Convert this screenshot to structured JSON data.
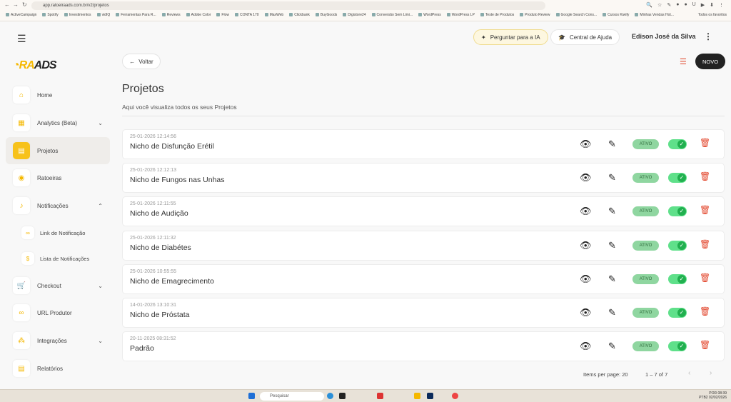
{
  "browser": {
    "url": "app.ratoeiraads.com.br/v2/projetos",
    "bookmarks": [
      "ActiveCampaign",
      "Spotify",
      "Investimentos",
      "vidIQ",
      "Ferramentas Para R...",
      "Reviews",
      "Adobe Color",
      "Flow",
      "CONTA 170",
      "MaxWeb",
      "Clickbank",
      "BuyGoods",
      "Digistore24",
      "Conversão Sem Limi...",
      "WordPress",
      "WordPress LP",
      "Teste de Produtos",
      "Produto Review",
      "Google Search Cons...",
      "Cursos Kiwify",
      "Minhas Vendas Hot..."
    ],
    "all_bookmarks": "Todos os favoritos"
  },
  "logo": {
    "part1": "RA",
    "part2": "ADS"
  },
  "sidebar": {
    "items": [
      {
        "label": "Home",
        "icon": "home-icon"
      },
      {
        "label": "Analytics (Beta)",
        "icon": "dashboard-icon"
      },
      {
        "label": "Projetos",
        "icon": "clipboard-icon"
      },
      {
        "label": "Ratoeiras",
        "icon": "mouse-icon"
      },
      {
        "label": "Notificações",
        "icon": "bell-icon"
      },
      {
        "label": "Link de Notificação",
        "icon": "link-icon"
      },
      {
        "label": "Lista de Notificações",
        "icon": "dollar-icon"
      },
      {
        "label": "Checkout",
        "icon": "cart-icon"
      },
      {
        "label": "URL Produtor",
        "icon": "link-icon"
      },
      {
        "label": "Integrações",
        "icon": "integrations-icon"
      },
      {
        "label": "Relatórios",
        "icon": "report-icon"
      }
    ]
  },
  "header": {
    "ask_ai": "Perguntar para a IA",
    "help": "Central de Ajuda",
    "user": "Edison José da Silva"
  },
  "toolbar": {
    "back": "Voltar",
    "new": "NOVO"
  },
  "page": {
    "title": "Projetos",
    "subtitle": "Aqui você visualiza todos os seus Projetos"
  },
  "projects": [
    {
      "date": "25-01-2026 12:14:56",
      "name": "Nicho de Disfunção Erétil",
      "status": "ATIVO",
      "enabled": true
    },
    {
      "date": "25-01-2026 12:12:13",
      "name": "Nicho de Fungos nas Unhas",
      "status": "ATIVO",
      "enabled": true
    },
    {
      "date": "25-01-2026 12:11:55",
      "name": "Nicho de Audição",
      "status": "ATIVO",
      "enabled": true
    },
    {
      "date": "25-01-2026 12:11:32",
      "name": "Nicho de Diabétes",
      "status": "ATIVO",
      "enabled": true
    },
    {
      "date": "25-01-2026 10:55:55",
      "name": "Nicho de Emagrecimento",
      "status": "ATIVO",
      "enabled": true
    },
    {
      "date": "14-01-2026 13:10:31",
      "name": "Nicho de Próstata",
      "status": "ATIVO",
      "enabled": true
    },
    {
      "date": "20-11-2025 08:31:52",
      "name": "Padrão",
      "status": "ATIVO",
      "enabled": true
    }
  ],
  "pagination": {
    "items_per_page": "Items per page: 20",
    "range": "1 – 7 of 7"
  },
  "taskbar": {
    "search": "Pesquisar",
    "lang": "POR",
    "layout": "PTB2",
    "time": "08:39",
    "date": "02/02/2026"
  },
  "colors": {
    "accent": "#f7c21b",
    "active_badge": "#8fd6a0",
    "toggle": "#21b04f",
    "delete": "#e2452b",
    "new_button": "#222222"
  }
}
